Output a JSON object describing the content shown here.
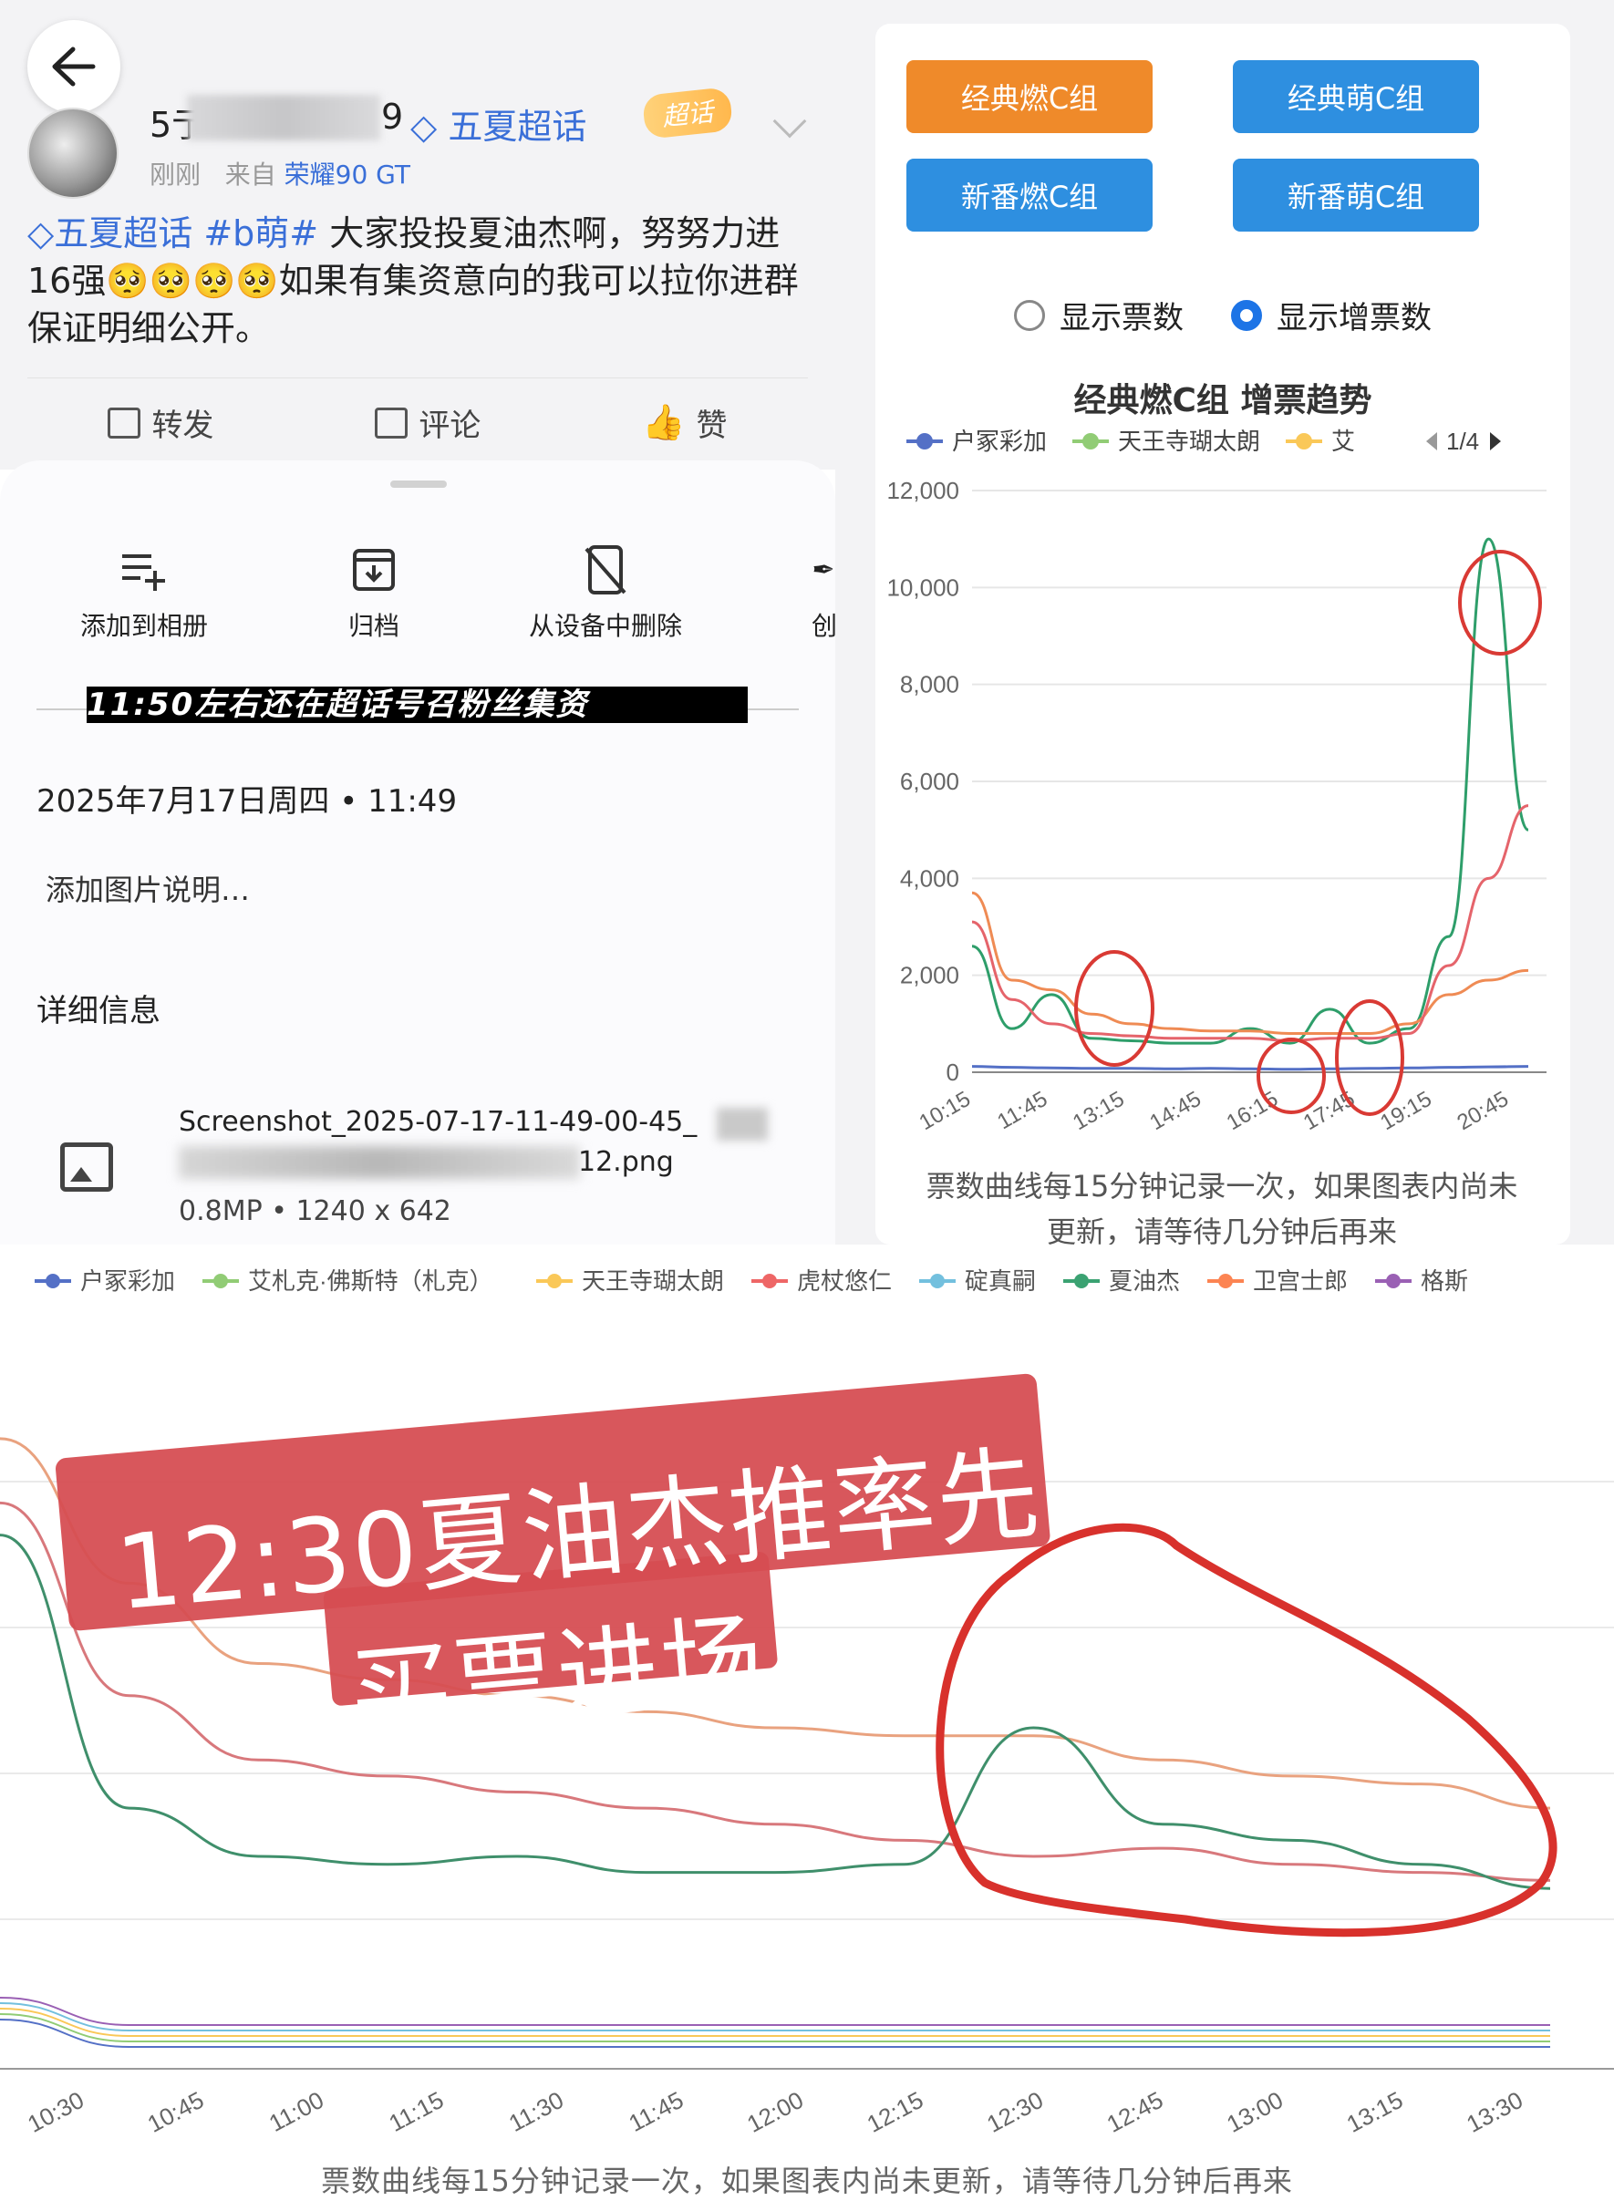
{
  "post": {
    "user_name_start": "5亍",
    "user_name_end": "9",
    "topic": "五夏超话",
    "super_tag": "超话",
    "meta_time": "刚刚",
    "meta_from": "来自",
    "meta_device": "荣耀90 GT",
    "text_tag1": "五夏超话",
    "text_tag2": "#b萌#",
    "text_line1": "大家投投夏油杰啊，努努力进",
    "text_line2_start": "16强",
    "text_emoji": "🥺🥺🥺🥺",
    "text_line2_end": "如果有集资意向的我可以拉你进群",
    "text_line3": "保证明细公开。",
    "action_repost": "转发",
    "action_comment": "评论",
    "action_like": "赞"
  },
  "sheet": {
    "add_album": "添加到相册",
    "archive": "归档",
    "delete_device": "从设备中删除",
    "create": "创",
    "overlay_caption": "11:50左右还在超话号召粉丝集资",
    "date": "2025年7月17日周四 • 11:49",
    "caption_placeholder": "添加图片说明…",
    "details": "详细信息",
    "file_name": "Screenshot_2025-07-17-11-49-00-45_",
    "file_name_end": "12.png",
    "file_meta": "0.8MP • 1240 x 642"
  },
  "right": {
    "btn_classic_ran": "经典燃C组",
    "btn_classic_meng": "经典萌C组",
    "btn_new_ran": "新番燃C组",
    "btn_new_meng": "新番萌C组",
    "radio_votes": "显示票数",
    "radio_increase": "显示增票数",
    "chart_title": "经典燃C组 增票趋势",
    "legend": [
      "户冢彩加",
      "天王寺瑚太朗",
      "艾"
    ],
    "legend_page": "1/4",
    "note": "票数曲线每15分钟记录一次，如果图表内尚未更新，请等待几分钟后再来",
    "colors": {
      "orange_btn": "#ef8a2a",
      "blue_btn": "#2e8fe0",
      "circle": "#d93a34"
    }
  },
  "bottom": {
    "banner_line1": "12:30夏油杰推率先",
    "banner_line2": "买票进场",
    "note": "票数曲线每15分钟记录一次，如果图表内尚未更新，请等待几分钟后再来"
  },
  "chart_data": [
    {
      "type": "line",
      "title": "经典燃C组 增票趋势",
      "x": [
        "10:15",
        "11:45",
        "13:15",
        "14:45",
        "16:15",
        "17:45",
        "19:15",
        "20:45"
      ],
      "ylim": [
        0,
        12000
      ],
      "yticks": [
        "0",
        "2,000",
        "4,000",
        "6,000",
        "8,000",
        "10,000",
        "12,000"
      ],
      "legend_visible": [
        "户冢彩加",
        "天王寺瑚太朗",
        "艾"
      ],
      "series": [
        {
          "name": "户冢彩加",
          "color": "#5470c6",
          "values": [
            120,
            100,
            90,
            80,
            80,
            70,
            80,
            70,
            60,
            70,
            80,
            90,
            100,
            110,
            120
          ]
        },
        {
          "name": "夏油杰",
          "color": "#2e9e6a",
          "values": [
            2600,
            900,
            1600,
            700,
            650,
            600,
            600,
            900,
            600,
            1300,
            600,
            900,
            2800,
            11000,
            5000
          ]
        },
        {
          "name": "卫宫士郎",
          "color": "#ef8b54",
          "values": [
            3700,
            1900,
            1700,
            1200,
            1000,
            900,
            850,
            850,
            800,
            800,
            800,
            1000,
            1600,
            1900,
            2100
          ]
        },
        {
          "name": "虎杖悠仁",
          "color": "#e5646b",
          "values": [
            3100,
            1500,
            1000,
            800,
            750,
            700,
            700,
            700,
            650,
            700,
            700,
            800,
            2200,
            4000,
            5500
          ]
        }
      ]
    },
    {
      "type": "line",
      "x": [
        "10:30",
        "10:45",
        "11:00",
        "11:15",
        "11:30",
        "11:45",
        "12:00",
        "12:15",
        "12:30",
        "12:45",
        "13:00",
        "13:15",
        "13:30"
      ],
      "legend": [
        "户冢彩加",
        "艾札克·佛斯特（札克）",
        "天王寺瑚太朗",
        "虎杖悠仁",
        "碇真嗣",
        "夏油杰",
        "卫宫士郎",
        "格斯"
      ],
      "legend_colors": [
        "#5470c6",
        "#91cc75",
        "#fac858",
        "#ee6666",
        "#73c0de",
        "#3ba272",
        "#fc8452",
        "#9a60b4"
      ],
      "series": [
        {
          "name": "卫宫士郎",
          "color": "#e9a27f",
          "values": [
            3900,
            3000,
            2500,
            2400,
            2300,
            2200,
            2100,
            2050,
            2050,
            1900,
            1800,
            1750,
            1600
          ]
        },
        {
          "name": "虎杖悠仁",
          "color": "#d8787c",
          "values": [
            3500,
            2300,
            1900,
            1800,
            1700,
            1600,
            1500,
            1400,
            1300,
            1350,
            1250,
            1200,
            1150
          ]
        },
        {
          "name": "夏油杰",
          "color": "#3f8f6b",
          "values": [
            3300,
            1600,
            1300,
            1250,
            1300,
            1200,
            1200,
            1250,
            2100,
            1500,
            1400,
            1250,
            1100
          ]
        }
      ]
    }
  ]
}
